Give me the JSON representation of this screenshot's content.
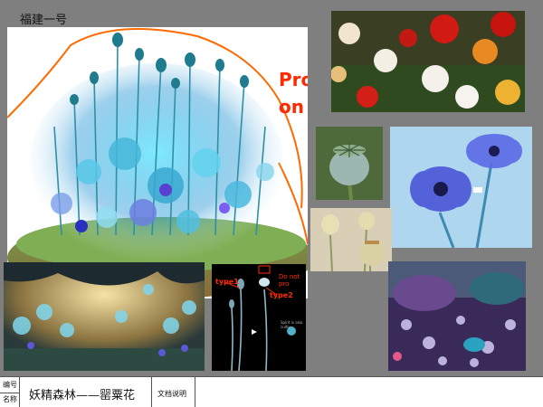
{
  "board": {
    "title": "福建一号",
    "main_overlay": {
      "line1": "Pro",
      "line2": "on"
    }
  },
  "panels": {
    "sketch_labels": {
      "type1": "type1",
      "type2": "type2",
      "do_not": "Do not pro",
      "note": "Spirit is also cultiv"
    }
  },
  "footer": {
    "label_number": "编号",
    "label_name": "名称",
    "name_value": "妖精森林——罂粟花",
    "doc_label": "文档说明"
  },
  "colors": {
    "accent_orange": "#ff6a00",
    "footer_bg": "#ffffff",
    "board_bg": "#7f7f7f"
  }
}
